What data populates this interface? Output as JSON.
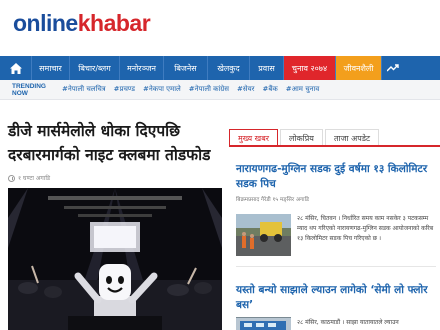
{
  "logo": {
    "part1": "online",
    "part2": "khabar"
  },
  "nav": {
    "items": [
      "समाचार",
      "बिचार/ब्लग",
      "मनोरञ्जन",
      "बिजनेस",
      "खेलकुद",
      "प्रवास"
    ],
    "election": "चुनाव २०७४",
    "lifestyle": "जीवनशैली"
  },
  "trending": {
    "label": "TRENDING NOW",
    "tags": [
      "#नेपाली चलचित्र",
      "#प्रचण्ड",
      "#नेकपा एमाले",
      "#नेपाली कांग्रेस",
      "#सेयर",
      "#बैंक",
      "#आम चुनाव"
    ]
  },
  "main": {
    "headline": "डीजे मार्समेलोले धोका दिएपछि दरबारमार्गको नाइट क्लबमा तोडफोड",
    "byline": "१ घण्टा अगाडि"
  },
  "side": {
    "tabs": [
      "मुख्य खबर",
      "लोकप्रिय",
      "ताजा अपडेट"
    ],
    "story1": {
      "title": "नारायणगढ-मुग्लिन सडक दुई वर्षमा १३ किलोमिटर सडक पिच",
      "byline": "बिक्रमप्रसाद गैरेडी १५ मङ्सिर अगाडि",
      "text": "२८ मंसिर, चितवन । निर्धारित समय काम नसकेर ३ पटकसम्म म्याद थप गरिएको नारायणगढ-मुग्लिन सडक आयोजनाको करिब १३ किलोमिटर सडक पिच गरिएको छ ।"
    },
    "story2": {
      "title": "यस्तो बन्यो साझाले ल्याउन लागेको ‘सेमी लो फ्लोर बस’",
      "text": "२८ मंसिर, काठमाडौं । साझा यातायातले ल्याउन"
    }
  },
  "colors": {
    "brand_blue": "#1e64ad",
    "brand_red": "#d6262b",
    "lifestyle_orange": "#f39f1c"
  }
}
